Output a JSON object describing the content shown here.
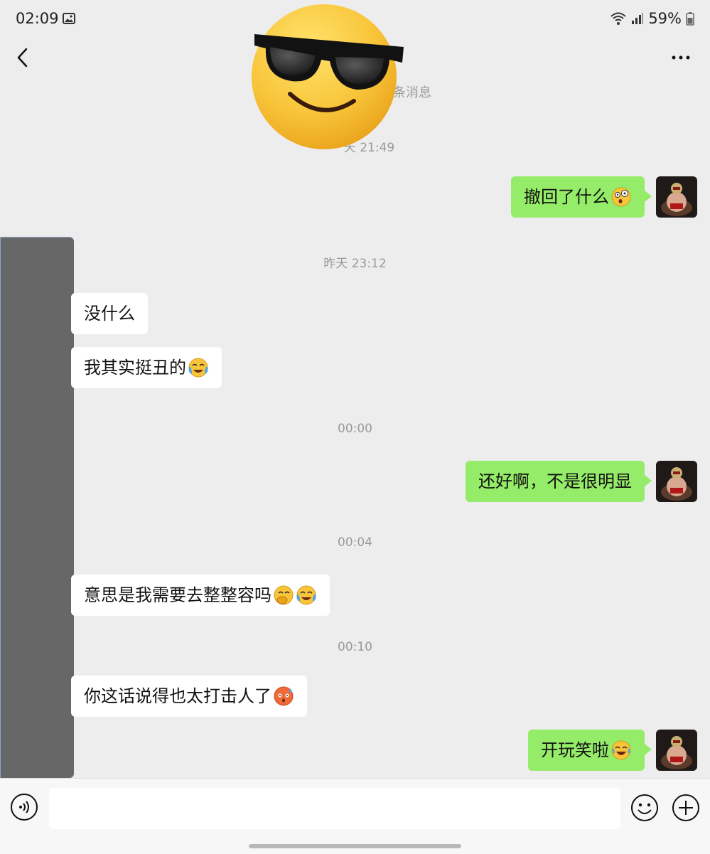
{
  "status_bar": {
    "time": "02:09",
    "battery": "59%"
  },
  "header": {
    "partial_notice": "条消息"
  },
  "timestamps": {
    "t1": "天 21:49",
    "t2": "昨天 23:12",
    "t3": "00:00",
    "t4": "00:04",
    "t5": "00:10"
  },
  "messages": [
    {
      "side": "me",
      "text": "撤回了什么"
    },
    {
      "side": "other",
      "text": "没什么"
    },
    {
      "side": "other",
      "text": "我其实挺丑的"
    },
    {
      "side": "me",
      "text": "还好啊，不是很明显"
    },
    {
      "side": "other",
      "text": "意思是我需要去整整容吗"
    },
    {
      "side": "other",
      "text": "你这话说得也太打击人了"
    },
    {
      "side": "me",
      "text": "开玩笑啦"
    }
  ],
  "input": {
    "value": "",
    "placeholder": ""
  },
  "colors": {
    "my_bubble": "#95ec69",
    "their_bubble": "#ffffff",
    "background": "#ededed"
  },
  "icons": [
    "back-icon",
    "more-icon",
    "voice-icon",
    "emoji-icon",
    "plus-icon",
    "photo-icon",
    "wifi-icon",
    "signal-icon",
    "battery-icon"
  ]
}
